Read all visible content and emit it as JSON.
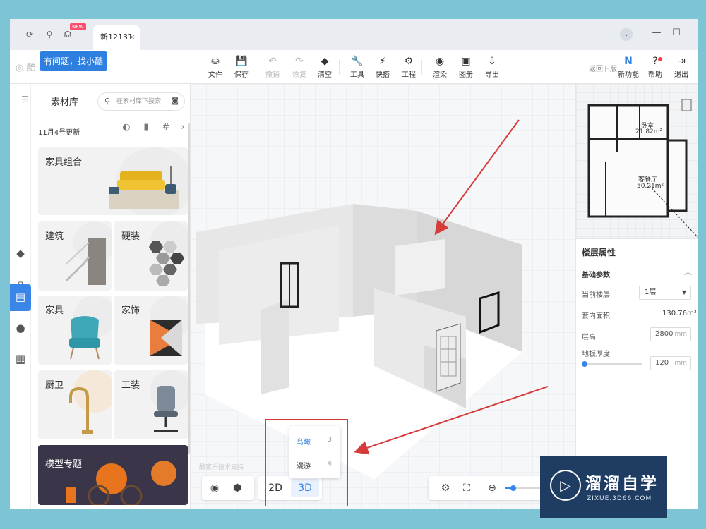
{
  "titlebar": {
    "new_badge": "NEW",
    "tab_title": "新12131",
    "tab_close": "×",
    "minimize": "—",
    "maximize": "☐"
  },
  "toolbar": {
    "logo_text": "酷",
    "tooltip": "有问题，找小酷",
    "tools": [
      {
        "label": "文件",
        "icon": "file-icon",
        "glyph": "⛀",
        "disabled": false
      },
      {
        "label": "保存",
        "icon": "save-icon",
        "glyph": "💾",
        "disabled": false
      },
      {
        "label": "撤销",
        "icon": "undo-icon",
        "glyph": "↶",
        "disabled": true
      },
      {
        "label": "恢复",
        "icon": "redo-icon",
        "glyph": "↷",
        "disabled": true
      },
      {
        "label": "清空",
        "icon": "eraser-icon",
        "glyph": "◆",
        "disabled": false
      },
      {
        "label": "工具",
        "icon": "wrench-icon",
        "glyph": "🔧",
        "disabled": false
      },
      {
        "label": "快搭",
        "icon": "lightning-icon",
        "glyph": "⚡",
        "disabled": false
      },
      {
        "label": "工程",
        "icon": "project-icon",
        "glyph": "⚙",
        "disabled": false
      },
      {
        "label": "渲染",
        "icon": "render-icon",
        "glyph": "◉",
        "disabled": false
      },
      {
        "label": "图册",
        "icon": "gallery-icon",
        "glyph": "▣",
        "disabled": false
      },
      {
        "label": "导出",
        "icon": "export-icon",
        "glyph": "⇩",
        "disabled": false
      }
    ],
    "back_old": "返回旧版",
    "new_features": "新功能",
    "help": "帮助",
    "logout": "退出"
  },
  "panel": {
    "title": "素材库",
    "search_placeholder": "在素材库下搜索",
    "update_text": "11月4号更新",
    "cards": {
      "combo": "家具组合",
      "building": "建筑",
      "hard": "硬装",
      "furniture": "家具",
      "decor": "家饰",
      "kitchen": "厨卫",
      "tooling": "工装",
      "model_topic": "模型专题"
    }
  },
  "canvas": {
    "watermark": "酷家乐技术支持",
    "view_2d": "2D",
    "view_3d": "3D",
    "mode_menu": [
      {
        "label": "鸟瞰",
        "key": "3"
      },
      {
        "label": "漫游",
        "key": "4"
      }
    ]
  },
  "minimap": {
    "bedroom_name": "卧室",
    "bedroom_area": "21.82m²",
    "living_name": "客餐厅",
    "living_area": "50.21m²"
  },
  "properties": {
    "title": "楼层属性",
    "section": "基础参数",
    "current_floor_label": "当前楼层",
    "current_floor_value": "1层",
    "inner_area_label": "套内面积",
    "inner_area_value": "130.76m²",
    "height_label": "层高",
    "height_value": "2800",
    "height_unit": "mm",
    "slab_label": "地板厚度",
    "slab_value": "120",
    "slab_unit": "mm",
    "slab_slider_fraction": 0.02
  },
  "brand": {
    "name_cn": "溜溜自学",
    "name_en": "ZIXUE.3D66.COM"
  },
  "colors": {
    "accent": "#3a86e8",
    "annotation_red": "#d63b3b",
    "background": "#7dc4d4"
  }
}
